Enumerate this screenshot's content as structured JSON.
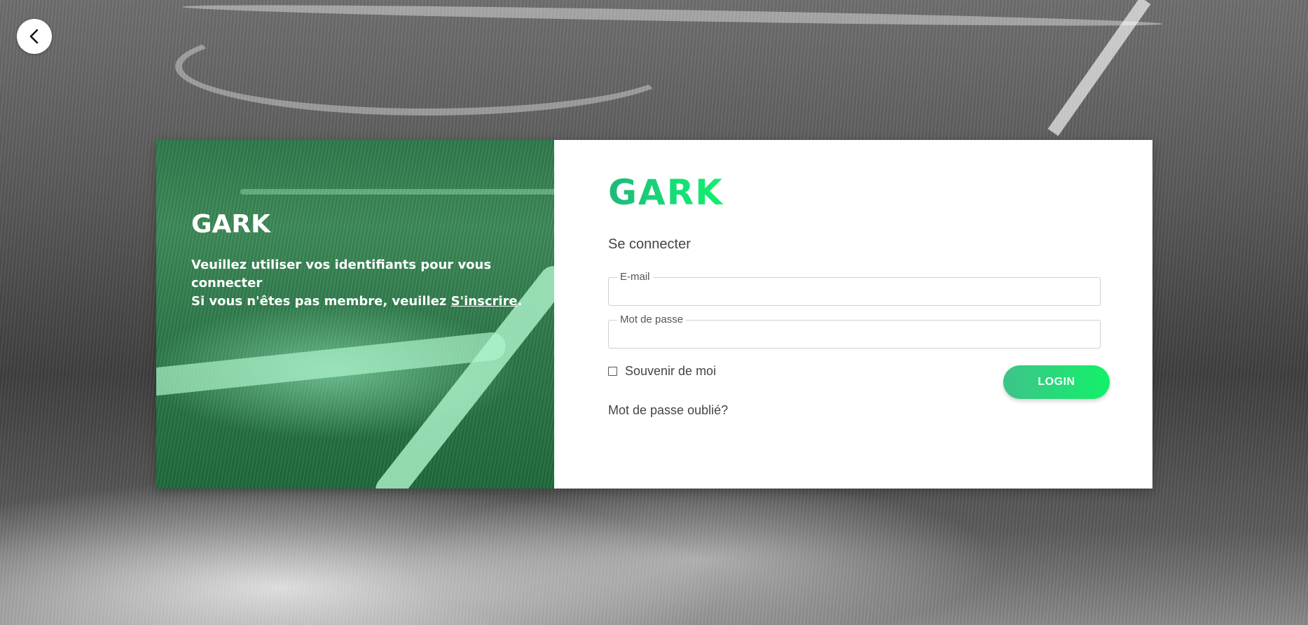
{
  "back_button": {
    "icon": "chevron-left-icon"
  },
  "left_panel": {
    "title": "GARK",
    "line1": "Veuillez utiliser vos identifiants pour vous connecter",
    "line2_prefix": "Si vous n'êtes pas membre, veuillez ",
    "signup_link": "S'inscrire",
    "line2_suffix": "."
  },
  "logo": "GARK",
  "form": {
    "title": "Se connecter",
    "email_label": "E-mail",
    "email_value": "",
    "password_label": "Mot de passe",
    "password_value": "",
    "remember_label": "Souvenir de moi",
    "remember_checked": false,
    "login_label": "LOGIN",
    "forgot_link": "Mot de passe oublié?"
  },
  "colors": {
    "brand_green": "#12f06d",
    "brand_teal": "#1fb77c",
    "text_gray": "#444444"
  }
}
